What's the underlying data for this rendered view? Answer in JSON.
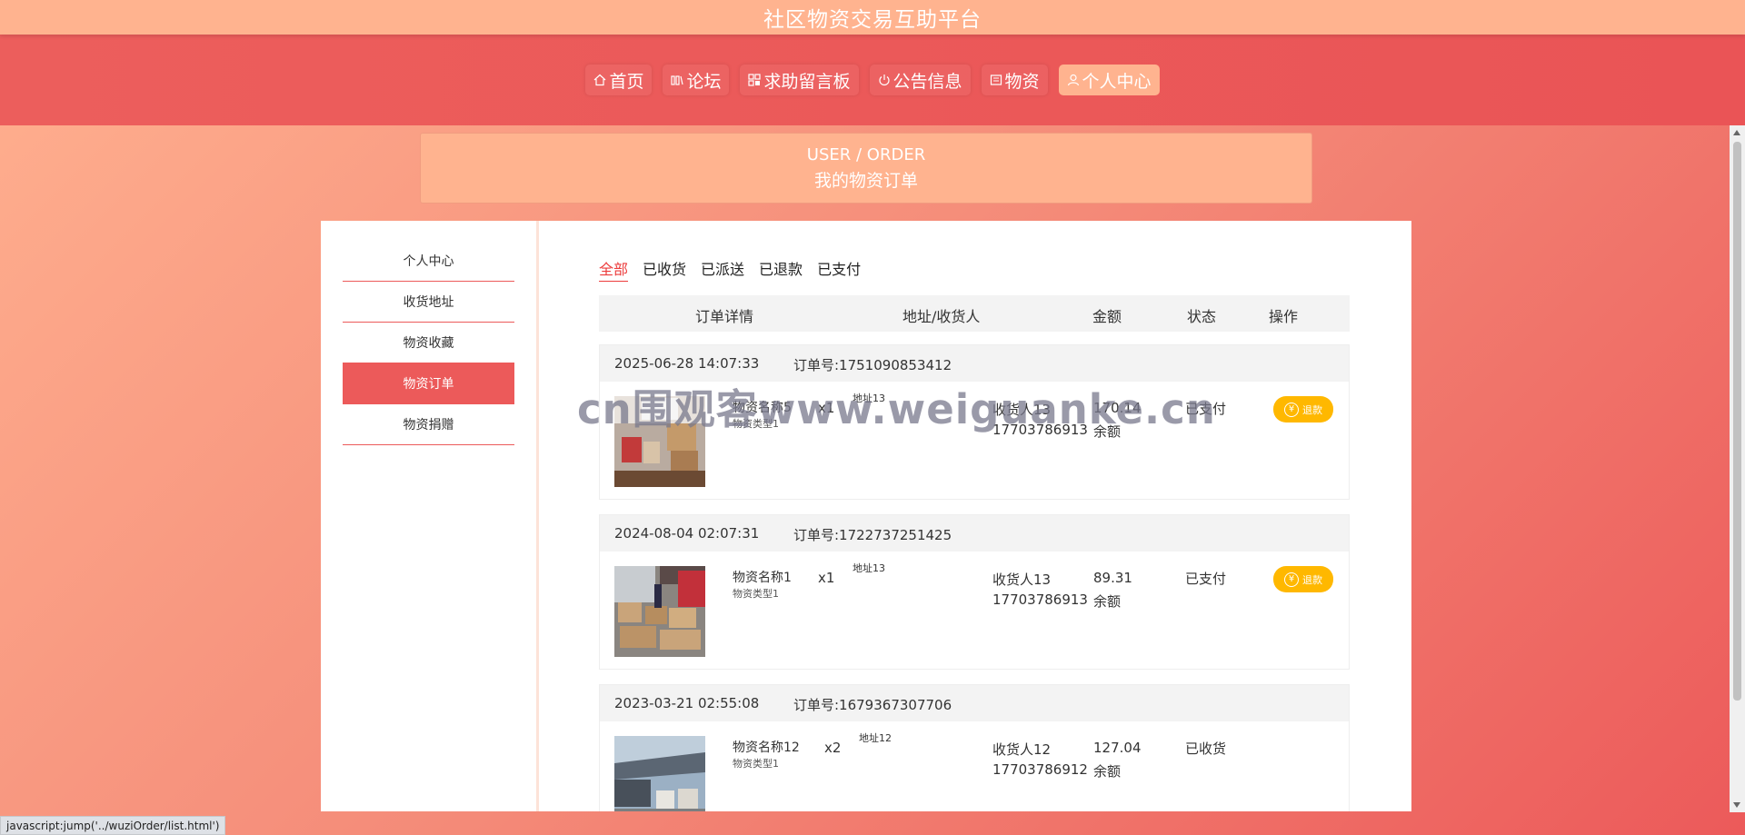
{
  "site_title": "社区物资交易互助平台",
  "nav": [
    {
      "label": "首页",
      "icon": "home-icon"
    },
    {
      "label": "论坛",
      "icon": "forum-icon"
    },
    {
      "label": "求助留言板",
      "icon": "grid-icon"
    },
    {
      "label": "公告信息",
      "icon": "power-icon"
    },
    {
      "label": "物资",
      "icon": "box-icon"
    },
    {
      "label": "个人中心",
      "icon": "user-icon",
      "active": true
    }
  ],
  "banner": {
    "en": "USER / ORDER",
    "zh": "我的物资订单"
  },
  "sidebar": [
    {
      "label": "个人中心"
    },
    {
      "label": "收货地址"
    },
    {
      "label": "物资收藏"
    },
    {
      "label": "物资订单",
      "active": true
    },
    {
      "label": "物资捐赠"
    }
  ],
  "tabs": [
    {
      "label": "全部",
      "active": true
    },
    {
      "label": "已收货"
    },
    {
      "label": "已派送"
    },
    {
      "label": "已退款"
    },
    {
      "label": "已支付"
    }
  ],
  "table_headers": [
    "订单详情",
    "地址/收货人",
    "金额",
    "状态",
    "操作"
  ],
  "orders": [
    {
      "date": "2025-06-28 14:07:33",
      "order_no": "订单号:1751090853412",
      "name": "物资名称5",
      "type": "物资类型1",
      "qty": "x1",
      "address": "地址13",
      "receiver": "收货人13",
      "phone": "17703786913",
      "amount": "170.14",
      "pay_method": "余额",
      "status": "已支付",
      "action": "退款"
    },
    {
      "date": "2024-08-04 02:07:31",
      "order_no": "订单号:1722737251425",
      "name": "物资名称1",
      "type": "物资类型1",
      "qty": "x1",
      "address": "地址13",
      "receiver": "收货人13",
      "phone": "17703786913",
      "amount": "89.31",
      "pay_method": "余额",
      "status": "已支付",
      "action": "退款"
    },
    {
      "date": "2023-03-21 02:55:08",
      "order_no": "订单号:1679367307706",
      "name": "物资名称12",
      "type": "物资类型1",
      "qty": "x2",
      "address": "地址12",
      "receiver": "收货人12",
      "phone": "17703786912",
      "amount": "127.04",
      "pay_method": "余额",
      "status": "已收货",
      "action": ""
    }
  ],
  "watermark": "cn围观客www.weiguanke.cn",
  "status_url": "javascript:jump('../wuziOrder/list.html')",
  "colors": {
    "primary": "#ec5a5a",
    "accent": "#ffb38f",
    "refund": "#ffb800"
  }
}
